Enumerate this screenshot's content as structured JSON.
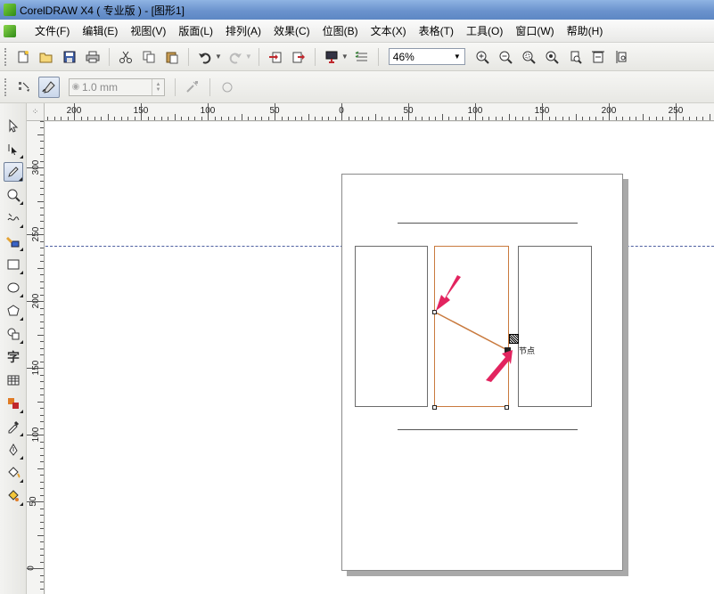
{
  "window": {
    "title": "CorelDRAW X4 ( 专业版 ) - [图形1]"
  },
  "menu": {
    "items": [
      "文件(F)",
      "编辑(E)",
      "视图(V)",
      "版面(L)",
      "排列(A)",
      "效果(C)",
      "位图(B)",
      "文本(X)",
      "表格(T)",
      "工具(O)",
      "窗口(W)",
      "帮助(H)"
    ]
  },
  "toolbar": {
    "zoom_value": "46%"
  },
  "propbar": {
    "nudge_value": "1.0 mm"
  },
  "rulers": {
    "horizontal_labels": [
      "200",
      "150",
      "100",
      "50",
      "0",
      "50",
      "100",
      "150",
      "200",
      "250"
    ],
    "vertical_labels": [
      "300",
      "250",
      "200",
      "150",
      "100",
      "50",
      "0"
    ]
  },
  "canvas": {
    "node_label": "节点"
  },
  "icons": {
    "toolbar": [
      "new-icon",
      "open-icon",
      "save-icon",
      "print-icon",
      "cut-icon",
      "copy-icon",
      "paste-icon",
      "undo-icon",
      "redo-icon",
      "import-icon",
      "export-icon",
      "app-launcher-icon",
      "welcome-icon",
      "zoom-in-icon",
      "zoom-out-icon",
      "zoom-selected-icon",
      "zoom-all-icon",
      "zoom-page-icon",
      "zoom-width-icon",
      "zoom-height-icon"
    ],
    "tools": [
      "pick-tool-icon",
      "shape-tool-icon",
      "freehand-tool-icon",
      "zoom-tool-icon",
      "smart-drawing-icon",
      "smart-fill-icon",
      "rectangle-tool-icon",
      "ellipse-tool-icon",
      "polygon-tool-icon",
      "basic-shapes-icon",
      "text-tool-icon",
      "table-tool-icon",
      "interactive-blend-icon",
      "eyedropper-icon",
      "outline-pen-icon",
      "fill-tool-icon",
      "interactive-fill-icon"
    ]
  },
  "colors": {
    "guide": "#4d5fa0",
    "selected_outline": "#c97a3e",
    "arrow": "#e2245f"
  }
}
